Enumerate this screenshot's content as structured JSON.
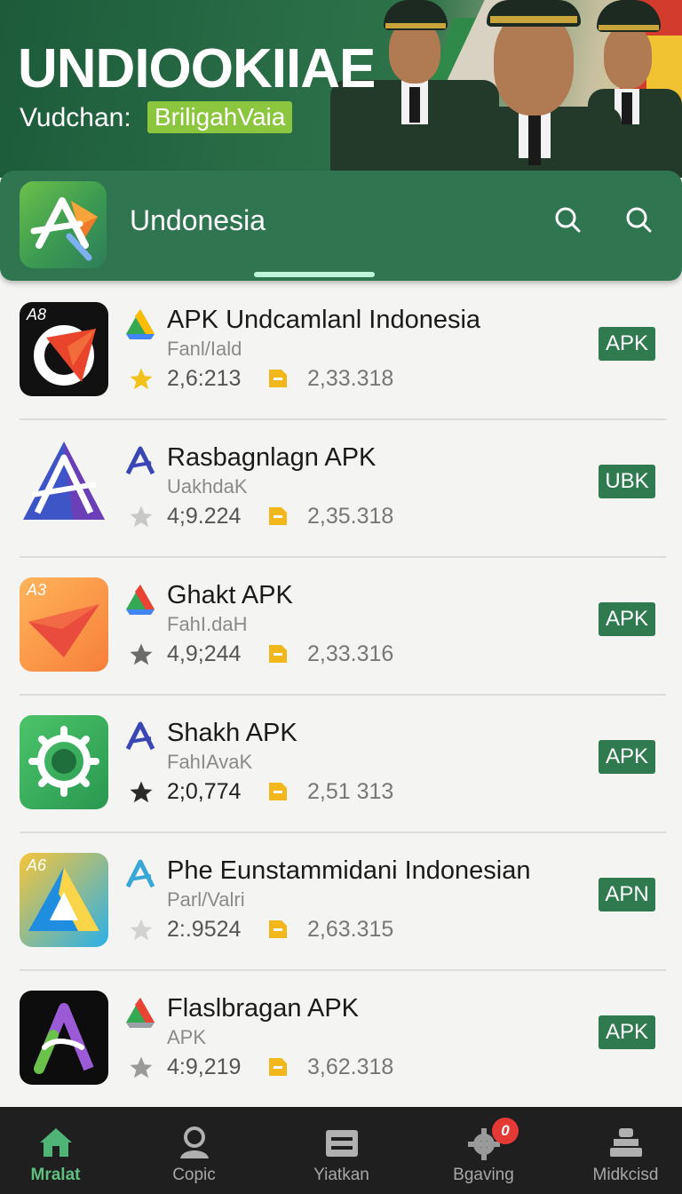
{
  "banner": {
    "title": "UNDIOOKIIAE",
    "subtitle": "Vudchan:",
    "tag": "BriligahVaia"
  },
  "header": {
    "title": "Undonesia",
    "accent": "#2f7650"
  },
  "apps": [
    {
      "name": "APK Undcamlanl Indonesia",
      "publisher": "Fanl/Iald",
      "rating": "2,6:213",
      "size": "2,33.318",
      "badge": "APK",
      "icon_label": "A8"
    },
    {
      "name": "Rasbagnlagn APK",
      "publisher": "UakhdaK",
      "rating": "4;9.224",
      "size": "2,35.318",
      "badge": "UBK",
      "icon_label": ""
    },
    {
      "name": "Ghakt APK",
      "publisher": "FahI.daH",
      "rating": "4,9;244",
      "size": "2,33.316",
      "badge": "APK",
      "icon_label": "A3"
    },
    {
      "name": "Shakh APK",
      "publisher": "FahIAvaK",
      "rating": "2;0,774",
      "size": "2,51 313",
      "badge": "APK",
      "icon_label": ""
    },
    {
      "name": "Phe Eunstammidani Indonesian",
      "publisher": "Parl/Valri",
      "rating": "2:.9524",
      "size": "2,63.315",
      "badge": "APN",
      "icon_label": "A6"
    },
    {
      "name": "Flaslbragan APK",
      "publisher": "APK",
      "rating": "4:9,219",
      "size": "3,62.318",
      "badge": "APK",
      "icon_label": ""
    }
  ],
  "nav": {
    "items": [
      {
        "label": "Mralat",
        "icon": "home-icon"
      },
      {
        "label": "Copic",
        "icon": "person-icon"
      },
      {
        "label": "Yiatkan",
        "icon": "list-icon"
      },
      {
        "label": "Bgaving",
        "icon": "gear-icon",
        "badge": "0"
      },
      {
        "label": "Midkcisd",
        "icon": "user-stack-icon"
      }
    ]
  }
}
